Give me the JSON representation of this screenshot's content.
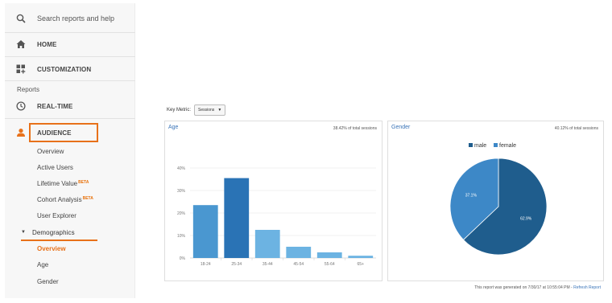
{
  "sidebar": {
    "search_placeholder": "Search reports and help",
    "home_label": "HOME",
    "customization_label": "CUSTOMIZATION",
    "reports_heading": "Reports",
    "realtime_label": "REAL-TIME",
    "audience_label": "AUDIENCE",
    "audience_items": [
      {
        "label": "Overview"
      },
      {
        "label": "Active Users"
      },
      {
        "label": "Lifetime Value",
        "badge": "BETA"
      },
      {
        "label": "Cohort Analysis",
        "badge": "BETA"
      },
      {
        "label": "User Explorer"
      }
    ],
    "demographics_label": "Demographics",
    "demographics_items": [
      {
        "label": "Overview"
      },
      {
        "label": "Age"
      },
      {
        "label": "Gender"
      }
    ]
  },
  "key_metric": {
    "label": "Key Metric:",
    "value": "Sessions"
  },
  "age_panel": {
    "title": "Age",
    "meta": "38.42% of total sessions"
  },
  "gender_panel": {
    "title": "Gender",
    "meta": "40.12% of total sessions"
  },
  "footer": {
    "note": "This report was generated on 7/30/17 at 10:55:04 PM -",
    "link": "Refresh Report"
  },
  "colors": {
    "accent": "#e8711a",
    "bar_light": "#4a97d0",
    "bar_dark": "#2a73b5",
    "pie_male": "#1f5d8d",
    "pie_female": "#3d88c7"
  },
  "chart_data": [
    {
      "type": "bar",
      "categories": [
        "18-24",
        "25-34",
        "35-44",
        "45-54",
        "55-64",
        "65+"
      ],
      "values": [
        23.5,
        35.5,
        12.5,
        5,
        2.5,
        1
      ],
      "ylim": [
        0,
        50
      ],
      "yticks": [
        "0%",
        "10%",
        "20%",
        "30%",
        "40%"
      ],
      "grid": true
    },
    {
      "type": "pie",
      "labels": [
        "male",
        "female"
      ],
      "values": [
        62.9,
        37.1
      ],
      "slice_labels": [
        "62.9%",
        "37.1%"
      ],
      "legend": "top"
    }
  ]
}
